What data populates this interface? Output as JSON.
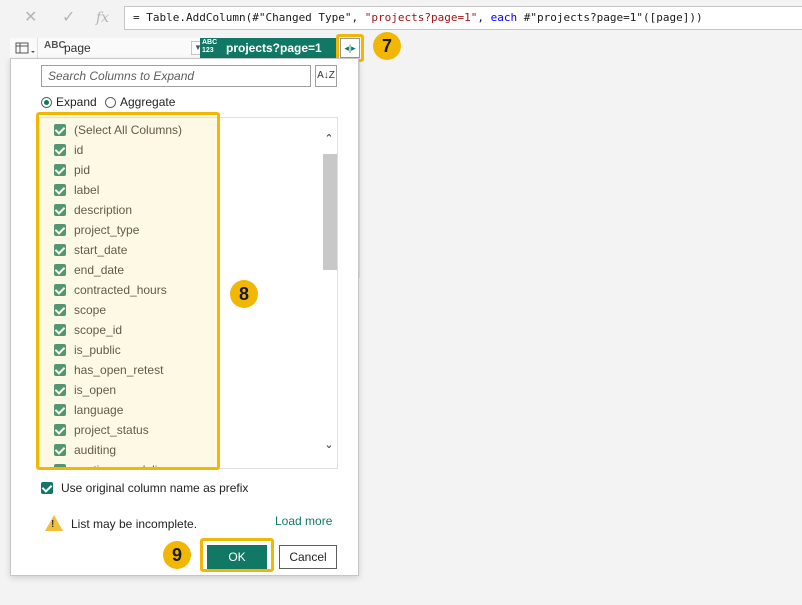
{
  "formula_bar": {
    "cancel_icon": "close-icon",
    "confirm_icon": "check-icon",
    "fx_label": "fx",
    "formula_prefix": "= Table.AddColumn(#\"Changed Type\", ",
    "formula_str": "\"projects?page=1\"",
    "formula_sep": ", ",
    "formula_kw": "each",
    "formula_suffix": " #\"projects?page=1\"([page]))"
  },
  "columns": {
    "page": {
      "type_label": "ABC",
      "name": "page"
    },
    "projects": {
      "type_label_top": "ABC",
      "type_label_bottom": "123",
      "name": "projects?page=1"
    }
  },
  "expand_panel": {
    "search_placeholder": "Search Columns to Expand",
    "sort_icon": "sort-az-icon",
    "radio_expand": "Expand",
    "radio_aggregate": "Aggregate",
    "selected_mode": "Expand",
    "items": [
      {
        "label": "(Select All Columns)",
        "checked": true
      },
      {
        "label": "id",
        "checked": true
      },
      {
        "label": "pid",
        "checked": true
      },
      {
        "label": "label",
        "checked": true
      },
      {
        "label": "description",
        "checked": true
      },
      {
        "label": "project_type",
        "checked": true
      },
      {
        "label": "start_date",
        "checked": true
      },
      {
        "label": "end_date",
        "checked": true
      },
      {
        "label": "contracted_hours",
        "checked": true
      },
      {
        "label": "scope",
        "checked": true
      },
      {
        "label": "scope_id",
        "checked": true
      },
      {
        "label": "is_public",
        "checked": true
      },
      {
        "label": "has_open_retest",
        "checked": true
      },
      {
        "label": "is_open",
        "checked": true
      },
      {
        "label": "language",
        "checked": true
      },
      {
        "label": "project_status",
        "checked": true
      },
      {
        "label": "auditing",
        "checked": true
      },
      {
        "label": "continuous_delivery",
        "checked": true
      }
    ],
    "prefix_label": "Use original column name as prefix",
    "prefix_checked": true,
    "warning_text": "List may be incomplete.",
    "load_more": "Load more",
    "ok_label": "OK",
    "cancel_label": "Cancel"
  },
  "callouts": {
    "step7": "7",
    "step8": "8",
    "step9": "9"
  },
  "colors": {
    "accent": "#117865",
    "highlight": "#f2b705"
  }
}
